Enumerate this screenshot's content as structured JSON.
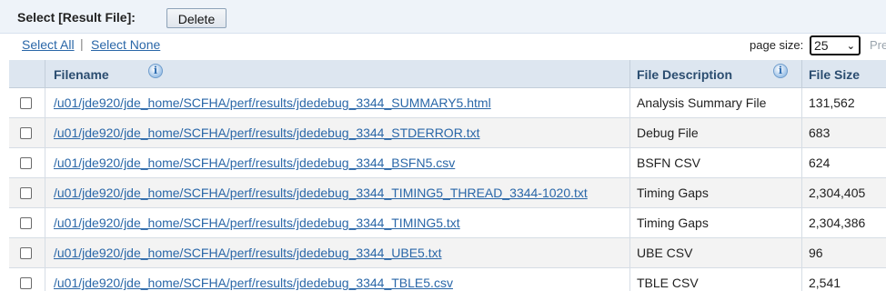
{
  "toolbar": {
    "title": "Select [Result File]:",
    "delete_label": "Delete"
  },
  "selection": {
    "select_all": "Select All",
    "separator": "|",
    "select_none": "Select None"
  },
  "paging": {
    "page_size_label": "page size:",
    "page_size_value": "25",
    "prev_label": "Pre"
  },
  "table": {
    "columns": {
      "filename": "Filename",
      "description": "File Description",
      "size": "File Size"
    },
    "rows": [
      {
        "filename": "/u01/jde920/jde_home/SCFHA/perf/results/jdedebug_3344_SUMMARY5.html",
        "description": "Analysis Summary File",
        "size": "131,562"
      },
      {
        "filename": "/u01/jde920/jde_home/SCFHA/perf/results/jdedebug_3344_STDERROR.txt",
        "description": "Debug File",
        "size": "683"
      },
      {
        "filename": "/u01/jde920/jde_home/SCFHA/perf/results/jdedebug_3344_BSFN5.csv",
        "description": "BSFN CSV",
        "size": "624"
      },
      {
        "filename": "/u01/jde920/jde_home/SCFHA/perf/results/jdedebug_3344_TIMING5_THREAD_3344-1020.txt",
        "description": "Timing Gaps",
        "size": "2,304,405"
      },
      {
        "filename": "/u01/jde920/jde_home/SCFHA/perf/results/jdedebug_3344_TIMING5.txt",
        "description": "Timing Gaps",
        "size": "2,304,386"
      },
      {
        "filename": "/u01/jde920/jde_home/SCFHA/perf/results/jdedebug_3344_UBE5.txt",
        "description": "UBE CSV",
        "size": "96"
      },
      {
        "filename": "/u01/jde920/jde_home/SCFHA/perf/results/jdedebug_3344_TBLE5.csv",
        "description": "TBLE CSV",
        "size": "2,541"
      }
    ]
  },
  "icons": {
    "info": "info-icon",
    "info_glyph": "i"
  }
}
